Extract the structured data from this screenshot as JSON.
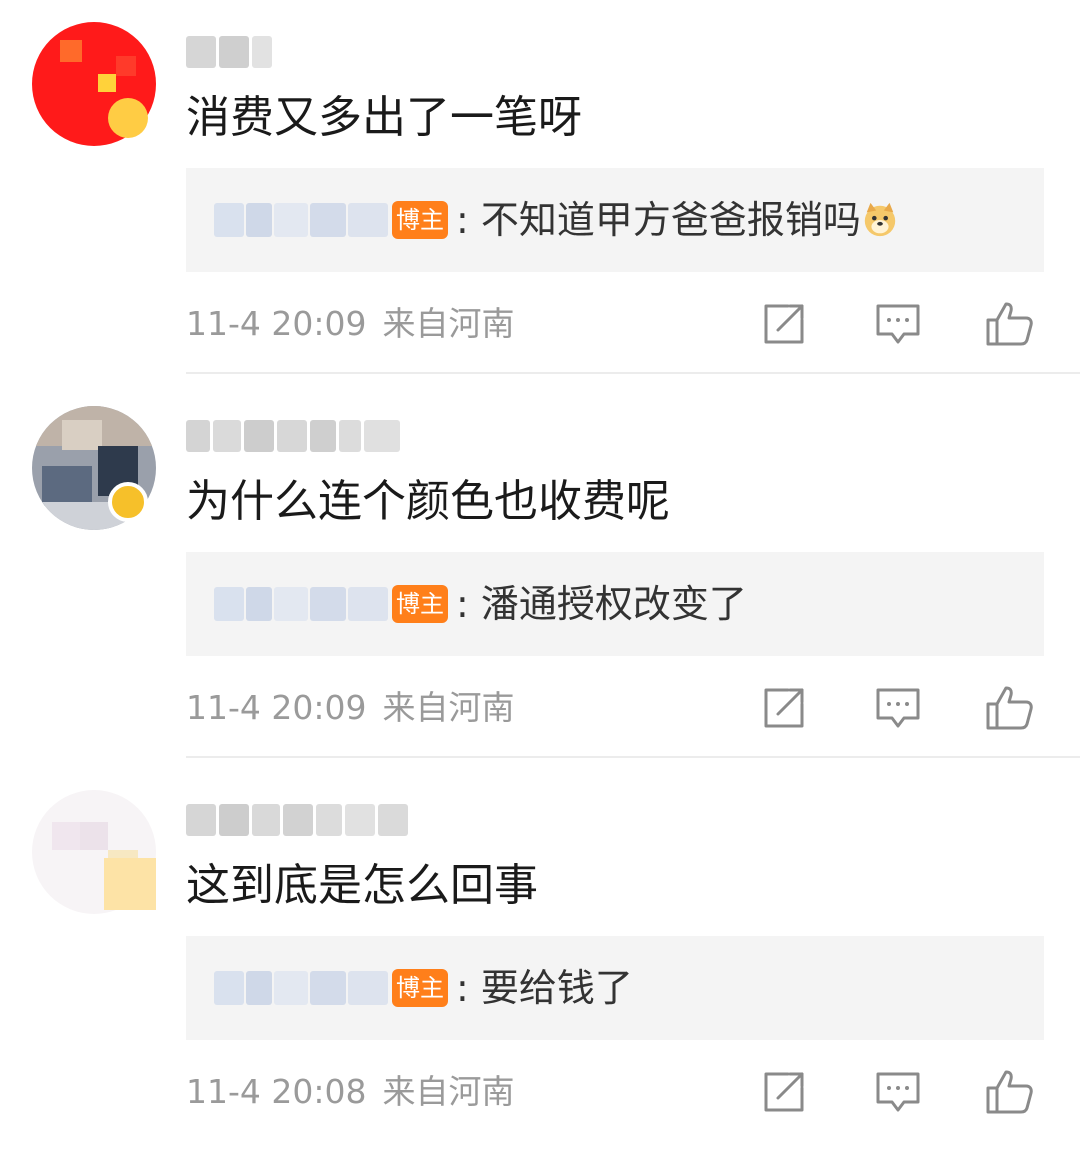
{
  "colors": {
    "background": "#ffffff",
    "reply_background": "#f4f4f4",
    "host_badge": "#ff7f1a",
    "meta_text": "#9a9a9a",
    "icon_stroke": "#8a8a8a"
  },
  "icons": {
    "share": "share-icon",
    "comment": "comment-icon",
    "like": "thumbs-up-icon",
    "emoji": "doge-emoji-icon"
  },
  "comments": [
    {
      "text": "消费又多出了一笔呀",
      "reply": {
        "badge": "博主",
        "text": ": 不知道甲方爸爸报销吗",
        "has_emoji": true
      },
      "time": "11-4 20:09",
      "location": "来自河南"
    },
    {
      "text": "为什么连个颜色也收费呢",
      "reply": {
        "badge": "博主",
        "text": ": 潘通授权改变了",
        "has_emoji": false
      },
      "time": "11-4 20:09",
      "location": "来自河南"
    },
    {
      "text": "这到底是怎么回事",
      "reply": {
        "badge": "博主",
        "text": ": 要给钱了",
        "has_emoji": false
      },
      "time": "11-4 20:08",
      "location": "来自河南"
    }
  ]
}
